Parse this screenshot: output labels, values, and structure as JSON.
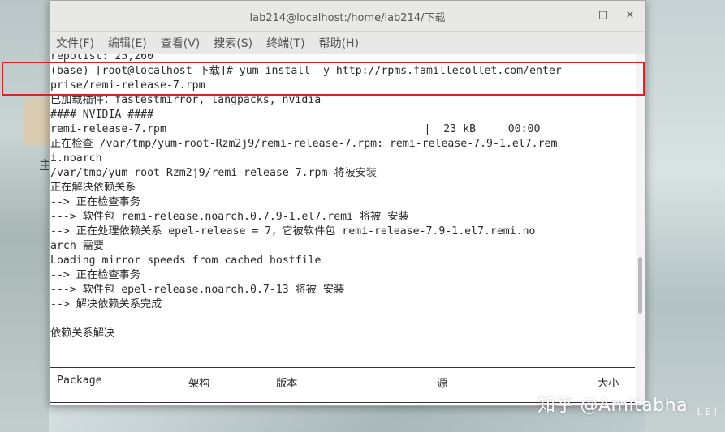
{
  "window": {
    "title": "lab214@localhost:/home/lab214/下载",
    "minimize_icon": "–",
    "maximize_icon": "□",
    "close_icon": "×"
  },
  "menu": [
    "文件(F)",
    "编辑(E)",
    "查看(V)",
    "搜索(S)",
    "终端(T)",
    "帮助(H)"
  ],
  "terminal_lines": [
    "repolist: 25,260",
    "(base) [root@localhost 下载]# yum install -y http://rpms.famillecollet.com/enter",
    "prise/remi-release-7.rpm",
    "已加载插件：fastestmirror, langpacks, nvidia",
    "#### NVIDIA ####",
    "remi-release-7.rpm                                        |  23 kB     00:00",
    "正在检查 /var/tmp/yum-root-Rzm2j9/remi-release-7.rpm: remi-release-7.9-1.el7.rem",
    "i.noarch",
    "/var/tmp/yum-root-Rzm2j9/remi-release-7.rpm 将被安装",
    "正在解决依赖关系",
    "--> 正在检查事务",
    "---> 软件包 remi-release.noarch.0.7.9-1.el7.remi 将被 安装",
    "--> 正在处理依赖关系 epel-release = 7，它被软件包 remi-release-7.9-1.el7.remi.no",
    "arch 需要",
    "Loading mirror speeds from cached hostfile",
    "--> 正在检查事务",
    "---> 软件包 epel-release.noarch.0.7-13 将被 安装",
    "--> 解决依赖关系完成",
    "",
    "依赖关系解决"
  ],
  "table_header": {
    "package": "Package",
    "arch": "架构",
    "version": "版本",
    "repo": "源",
    "size": "大小"
  },
  "desktop": {
    "left_glyph": "主",
    "right_lettering": "LEI"
  },
  "watermark": "知乎 @Amitabha",
  "colors": {
    "highlight": "#d8232a",
    "terminal_bg": "#ffffff",
    "terminal_fg": "#2a2a2a",
    "titlebar_bg": "#e8e8e7"
  }
}
